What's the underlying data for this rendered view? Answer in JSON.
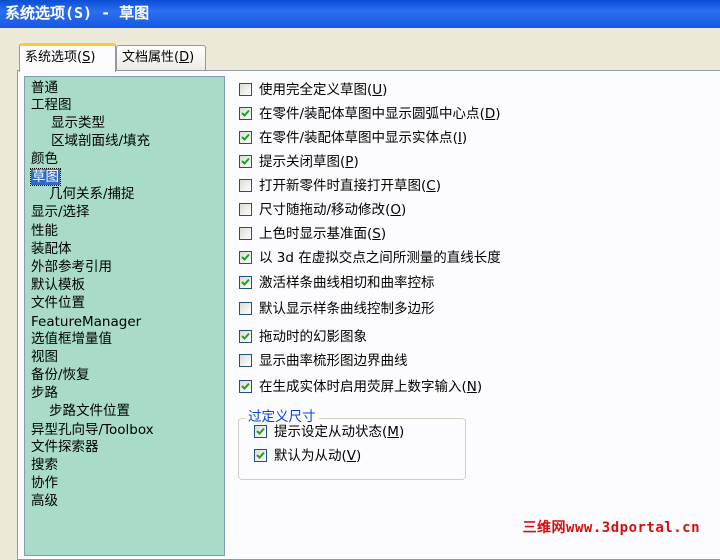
{
  "window": {
    "title": "系统选项(S) - 草图"
  },
  "tabs": [
    {
      "label": "系统选项",
      "mnemonic": "S"
    },
    {
      "label": "文档属性",
      "mnemonic": "D"
    }
  ],
  "tree": {
    "items": [
      {
        "label": "普通"
      },
      {
        "label": "工程图"
      },
      {
        "label": "显示类型"
      },
      {
        "label": "区域剖面线/填充"
      },
      {
        "label": "颜色"
      },
      {
        "label": "草图",
        "selected": true
      },
      {
        "label": "几何关系/捕捉"
      },
      {
        "label": "显示/选择"
      },
      {
        "label": "性能"
      },
      {
        "label": "装配体"
      },
      {
        "label": "外部参考引用"
      },
      {
        "label": "默认模板"
      },
      {
        "label": "文件位置"
      },
      {
        "label": "FeatureManager"
      },
      {
        "label": "选值框增量值"
      },
      {
        "label": "视图"
      },
      {
        "label": "备份/恢复"
      },
      {
        "label": "步路"
      },
      {
        "label": "步路文件位置"
      },
      {
        "label": "异型孔向导/Toolbox"
      },
      {
        "label": "文件探索器"
      },
      {
        "label": "搜索"
      },
      {
        "label": "协作"
      },
      {
        "label": "高级"
      }
    ]
  },
  "options": [
    {
      "label": "使用完全定义草图",
      "mnemonic": "U",
      "checked": false
    },
    {
      "label": "在零件/装配体草图中显示圆弧中心点",
      "mnemonic": "D",
      "checked": true
    },
    {
      "label": "在零件/装配体草图中显示实体点",
      "mnemonic": "I",
      "checked": true
    },
    {
      "label": "提示关闭草图",
      "mnemonic": "P",
      "checked": true
    },
    {
      "label": "打开新零件时直接打开草图",
      "mnemonic": "C",
      "checked": false
    },
    {
      "label": "尺寸随拖动/移动修改",
      "mnemonic": "O",
      "checked": false
    },
    {
      "label": "上色时显示基准面",
      "mnemonic": "S",
      "checked": false
    },
    {
      "label": "以 3d 在虚拟交点之间所测量的直线长度",
      "mnemonic": "",
      "checked": true
    },
    {
      "label": "激活样条曲线相切和曲率控标",
      "mnemonic": "",
      "checked": true
    },
    {
      "label": "默认显示样条曲线控制多边形",
      "mnemonic": "",
      "checked": false
    },
    {
      "label": "拖动时的幻影图象",
      "mnemonic": "",
      "checked": true
    },
    {
      "label": "显示曲率梳形图边界曲线",
      "mnemonic": "",
      "checked": false
    },
    {
      "label": "在生成实体时启用荧屏上数字输入",
      "mnemonic": "N",
      "checked": true
    }
  ],
  "overdefined_group": {
    "title": "过定义尺寸",
    "options": [
      {
        "label": "提示设定从动状态",
        "mnemonic": "M",
        "checked": true
      },
      {
        "label": "默认为从动",
        "mnemonic": "V",
        "checked": true
      }
    ]
  },
  "watermark": {
    "text": "三维网www.3dportal.cn"
  }
}
